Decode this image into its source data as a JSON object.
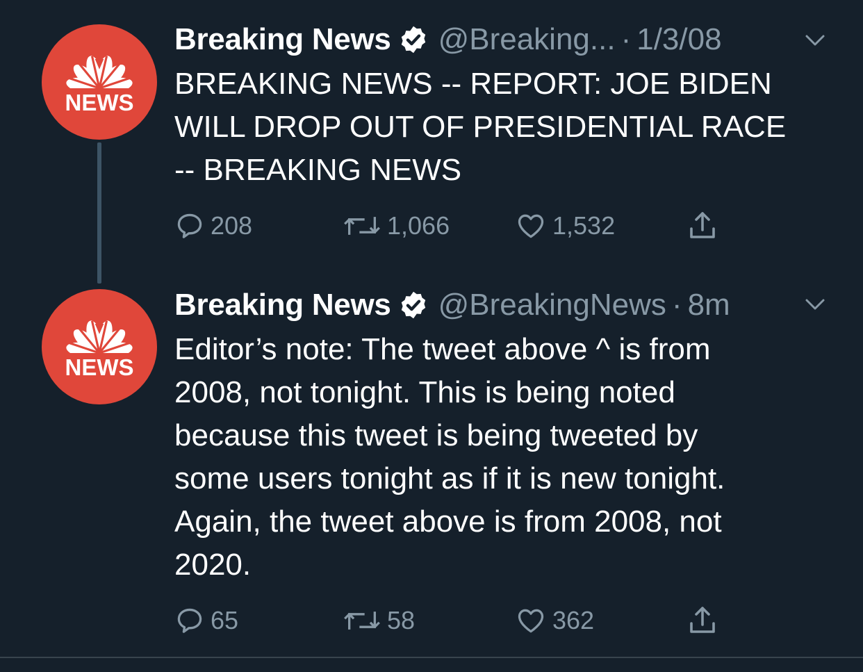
{
  "colors": {
    "background": "#15202b",
    "text_primary": "#ffffff",
    "text_secondary": "#8899a6",
    "avatar_red": "#e0473a",
    "thread_line": "#3d5466"
  },
  "tweets": [
    {
      "avatar": {
        "icon": "peacock-logo",
        "label": "NEWS"
      },
      "display_name": "Breaking News",
      "verified_icon": "verified-badge-icon",
      "handle": "@Breaking...",
      "separator": "·",
      "timestamp": "1/3/08",
      "body": "BREAKING NEWS -- REPORT: JOE BIDEN\nWILL DROP OUT OF PRESIDENTIAL RACE\n-- BREAKING NEWS",
      "actions": {
        "replies": "208",
        "retweets": "1,066",
        "likes": "1,532"
      }
    },
    {
      "avatar": {
        "icon": "peacock-logo",
        "label": "NEWS"
      },
      "display_name": "Breaking News",
      "verified_icon": "verified-badge-icon",
      "handle": "@BreakingNews",
      "separator": "·",
      "timestamp": "8m",
      "body": "Editor’s note: The tweet above ^ is from\n2008, not tonight. This is being noted\nbecause this tweet is being tweeted by\nsome users tonight as if it is new tonight.\nAgain, the tweet above is from 2008, not\n2020.",
      "actions": {
        "replies": "65",
        "retweets": "58",
        "likes": "362"
      }
    }
  ]
}
